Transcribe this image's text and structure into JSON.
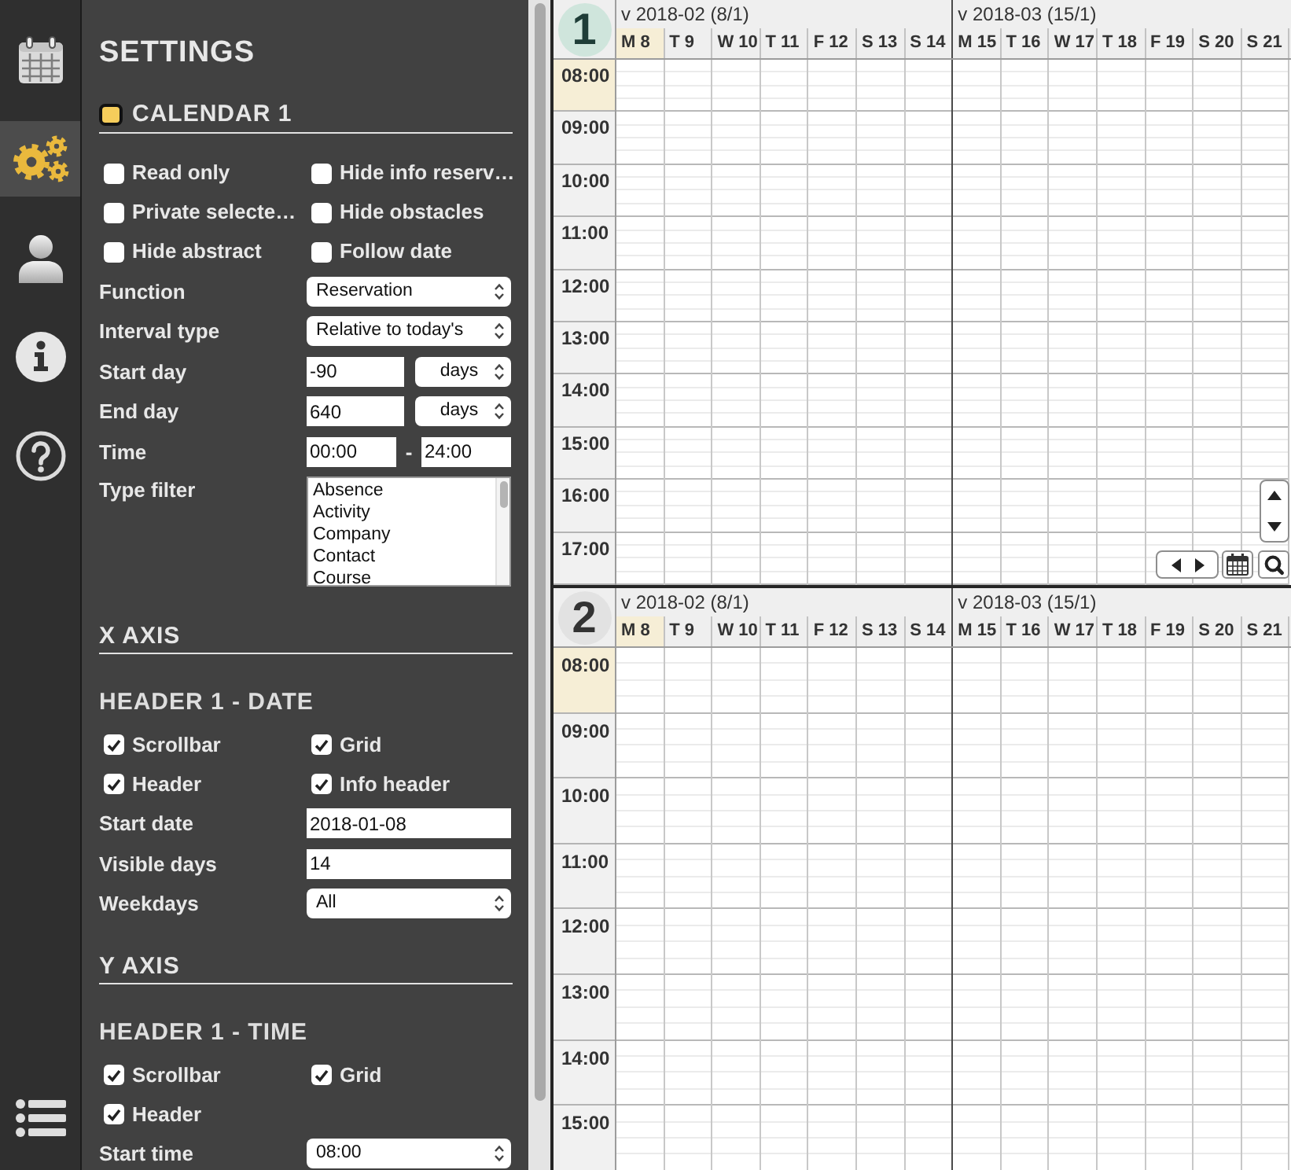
{
  "nav_rail": {
    "items": [
      {
        "kind": "calendar",
        "selected": false
      },
      {
        "kind": "settings",
        "selected": true
      },
      {
        "kind": "user",
        "selected": false
      },
      {
        "kind": "info",
        "selected": false
      },
      {
        "kind": "help",
        "selected": false
      },
      {
        "kind": "list",
        "selected": false
      }
    ]
  },
  "settings": {
    "title": "SETTINGS",
    "rows": [
      {
        "kind": "heading",
        "text": "CALENDAR 1",
        "color": "#f6cd5b"
      },
      {
        "kind": "checkboxes",
        "items": [
          {
            "label": "Read only",
            "checked": false
          },
          {
            "label": "Hide info reserv…",
            "checked": false
          },
          {
            "label": "Private selecte…",
            "checked": false
          },
          {
            "label": "Hide obstacles",
            "checked": false
          },
          {
            "label": "Hide abstract",
            "checked": false
          },
          {
            "label": "Follow date",
            "checked": false
          }
        ]
      },
      {
        "kind": "select",
        "label": "Function",
        "value": "Reservation"
      },
      {
        "kind": "select",
        "label": "Interval type",
        "value": "Relative to today's"
      },
      {
        "kind": "number_unit",
        "label": "Start day",
        "value": "-90",
        "unit": "days"
      },
      {
        "kind": "number_unit",
        "label": "End day",
        "value": "640",
        "unit": "days"
      },
      {
        "kind": "time_range",
        "label": "Time",
        "from": "00:00",
        "separator": "-",
        "to": "24:00"
      },
      {
        "kind": "listbox",
        "label": "Type filter",
        "options": [
          {
            "label": "Absence",
            "selected": false
          },
          {
            "label": "Activity",
            "selected": false
          },
          {
            "label": "Company",
            "selected": false
          },
          {
            "label": "Contact",
            "selected": false
          },
          {
            "label": "Course",
            "selected": false
          }
        ]
      },
      {
        "kind": "heading",
        "text": "X AXIS"
      },
      {
        "kind": "subheading",
        "text": "HEADER 1 - DATE"
      },
      {
        "kind": "checkboxes",
        "items": [
          {
            "label": "Scrollbar",
            "checked": true
          },
          {
            "label": "Grid",
            "checked": true
          },
          {
            "label": "Header",
            "checked": true
          },
          {
            "label": "Info header",
            "checked": true
          }
        ]
      },
      {
        "kind": "input",
        "label": "Start date",
        "value": "2018-01-08"
      },
      {
        "kind": "input",
        "label": "Visible days",
        "value": "14"
      },
      {
        "kind": "select",
        "label": "Weekdays",
        "value": "All"
      },
      {
        "kind": "heading",
        "text": "Y AXIS"
      },
      {
        "kind": "subheading",
        "text": "HEADER 1 - TIME"
      },
      {
        "kind": "checkboxes",
        "items": [
          {
            "label": "Scrollbar",
            "checked": true
          },
          {
            "label": "Grid",
            "checked": true
          },
          {
            "label": "Header",
            "checked": true
          }
        ]
      },
      {
        "kind": "select",
        "label": "Start time",
        "value": "08:00"
      }
    ]
  },
  "calendars": [
    {
      "number": "1",
      "nav_controls": true,
      "weeks": [
        {
          "label": "v 2018-02 (8/1)",
          "days": [
            {
              "label": "M 8",
              "highlighted": true
            },
            {
              "label": "T 9",
              "highlighted": false
            },
            {
              "label": "W 10",
              "highlighted": false
            },
            {
              "label": "T 11",
              "highlighted": false
            },
            {
              "label": "F 12",
              "highlighted": false
            },
            {
              "label": "S 13",
              "highlighted": false
            },
            {
              "label": "S 14",
              "highlighted": false
            }
          ]
        },
        {
          "label": "v 2018-03 (15/1)",
          "days": [
            {
              "label": "M 15",
              "highlighted": false
            },
            {
              "label": "T 16",
              "highlighted": false
            },
            {
              "label": "W 17",
              "highlighted": false
            },
            {
              "label": "T 18",
              "highlighted": false
            },
            {
              "label": "F 19",
              "highlighted": false
            },
            {
              "label": "S 20",
              "highlighted": false
            },
            {
              "label": "S 21",
              "highlighted": false
            }
          ]
        }
      ],
      "hours": [
        {
          "label": "08:00",
          "highlighted": true
        },
        {
          "label": "09:00",
          "highlighted": false
        },
        {
          "label": "10:00",
          "highlighted": false
        },
        {
          "label": "11:00",
          "highlighted": false
        },
        {
          "label": "12:00",
          "highlighted": false
        },
        {
          "label": "13:00",
          "highlighted": false
        },
        {
          "label": "14:00",
          "highlighted": false
        },
        {
          "label": "15:00",
          "highlighted": false
        },
        {
          "label": "16:00",
          "highlighted": false
        },
        {
          "label": "17:00",
          "highlighted": false
        }
      ]
    },
    {
      "number": "2",
      "weeks": [
        {
          "label": "v 2018-02 (8/1)",
          "days": [
            {
              "label": "M 8",
              "highlighted": true
            },
            {
              "label": "T 9",
              "highlighted": false
            },
            {
              "label": "W 10",
              "highlighted": false
            },
            {
              "label": "T 11",
              "highlighted": false
            },
            {
              "label": "F 12",
              "highlighted": false
            },
            {
              "label": "S 13",
              "highlighted": false
            },
            {
              "label": "S 14",
              "highlighted": false
            }
          ]
        },
        {
          "label": "v 2018-03 (15/1)",
          "days": [
            {
              "label": "M 15",
              "highlighted": false
            },
            {
              "label": "T 16",
              "highlighted": false
            },
            {
              "label": "W 17",
              "highlighted": false
            },
            {
              "label": "T 18",
              "highlighted": false
            },
            {
              "label": "F 19",
              "highlighted": false
            },
            {
              "label": "S 20",
              "highlighted": false
            },
            {
              "label": "S 21",
              "highlighted": false
            }
          ]
        }
      ],
      "hours": [
        {
          "label": "08:00",
          "highlighted": true
        },
        {
          "label": "09:00",
          "highlighted": false
        },
        {
          "label": "10:00",
          "highlighted": false
        },
        {
          "label": "11:00",
          "highlighted": false
        },
        {
          "label": "12:00",
          "highlighted": false
        },
        {
          "label": "13:00",
          "highlighted": false
        },
        {
          "label": "14:00",
          "highlighted": false
        },
        {
          "label": "15:00",
          "highlighted": false
        }
      ]
    }
  ]
}
